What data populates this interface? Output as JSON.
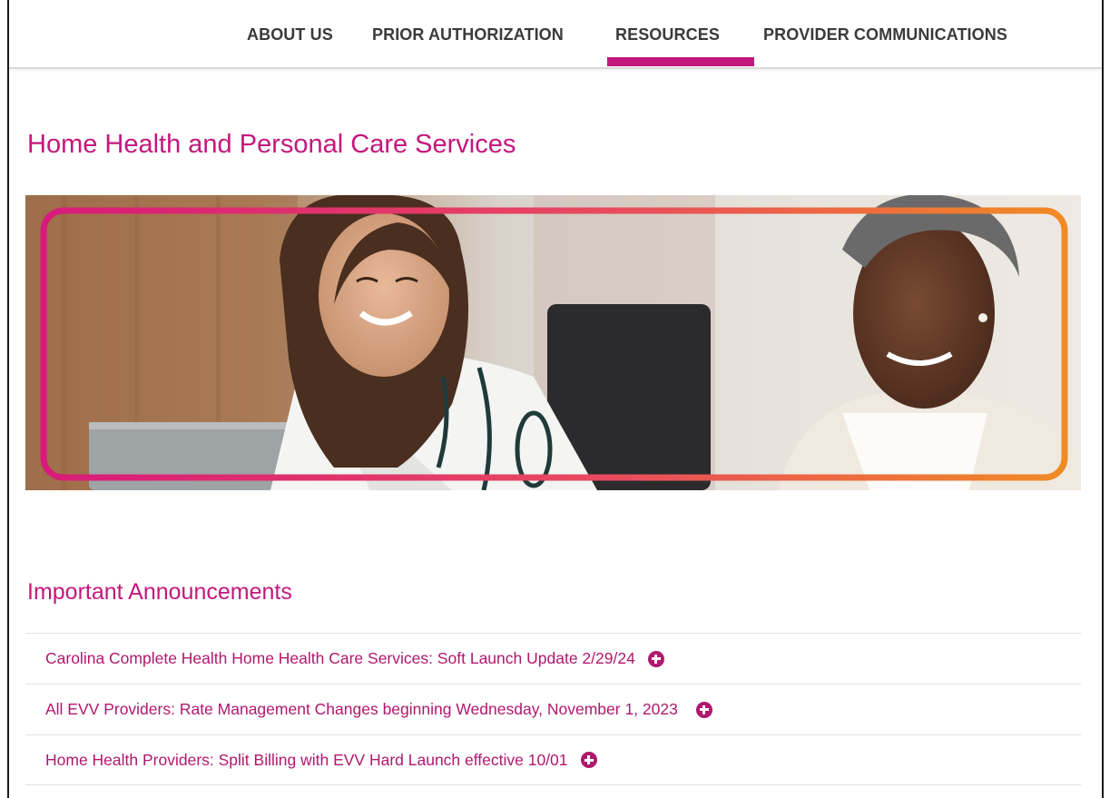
{
  "nav": {
    "items": [
      {
        "label": "ABOUT US"
      },
      {
        "label": "PRIOR AUTHORIZATION"
      },
      {
        "label": "RESOURCES",
        "active": true
      },
      {
        "label": "PROVIDER COMMUNICATIONS"
      }
    ]
  },
  "page": {
    "title": "Home Health and Personal Care Services"
  },
  "announcements": {
    "heading": "Important Announcements",
    "items": [
      {
        "text": "Carolina Complete Health Home Health Care Services: Soft Launch Update 2/29/24",
        "icon": "plus-circle-icon"
      },
      {
        "text": "All EVV Providers: Rate Management Changes beginning Wednesday, November 1, 2023",
        "icon": "plus-circle-icon"
      },
      {
        "text": "Home Health Providers: Split Billing with EVV Hard Launch effective 10/01",
        "icon": "plus-circle-icon"
      }
    ]
  },
  "colors": {
    "accent": "#c4177c",
    "frame_gradient_start": "#d81b7a",
    "frame_gradient_end": "#f08a24"
  }
}
